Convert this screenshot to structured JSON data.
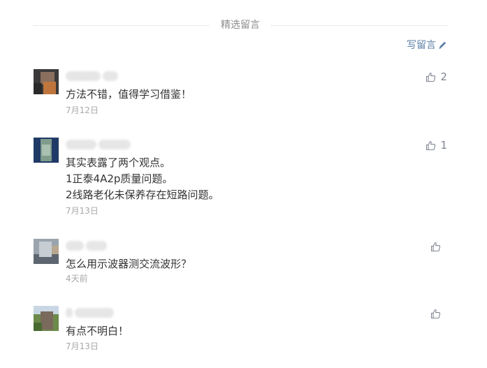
{
  "section": {
    "title": "精选留言",
    "write_label": "写留言"
  },
  "comments": [
    {
      "text": "方法不错，值得学习借鉴！",
      "time": "7月12日",
      "likes": "2"
    },
    {
      "text": "其实表露了两个观点。\n1正泰4A2p质量问题。\n2线路老化未保养存在短路问题。",
      "time": "7月13日",
      "likes": "1"
    },
    {
      "text": "怎么用示波器测交流波形？",
      "time": "4天前",
      "likes": ""
    },
    {
      "text": "有点不明白！",
      "time": "7月13日",
      "likes": ""
    }
  ],
  "colors": {
    "link": "#5d7fa8",
    "text": "#333333",
    "muted": "#a8a8a8",
    "divider": "#d9d9d9"
  },
  "icons": {
    "write": "pencil-icon",
    "like": "thumbs-up-icon"
  }
}
